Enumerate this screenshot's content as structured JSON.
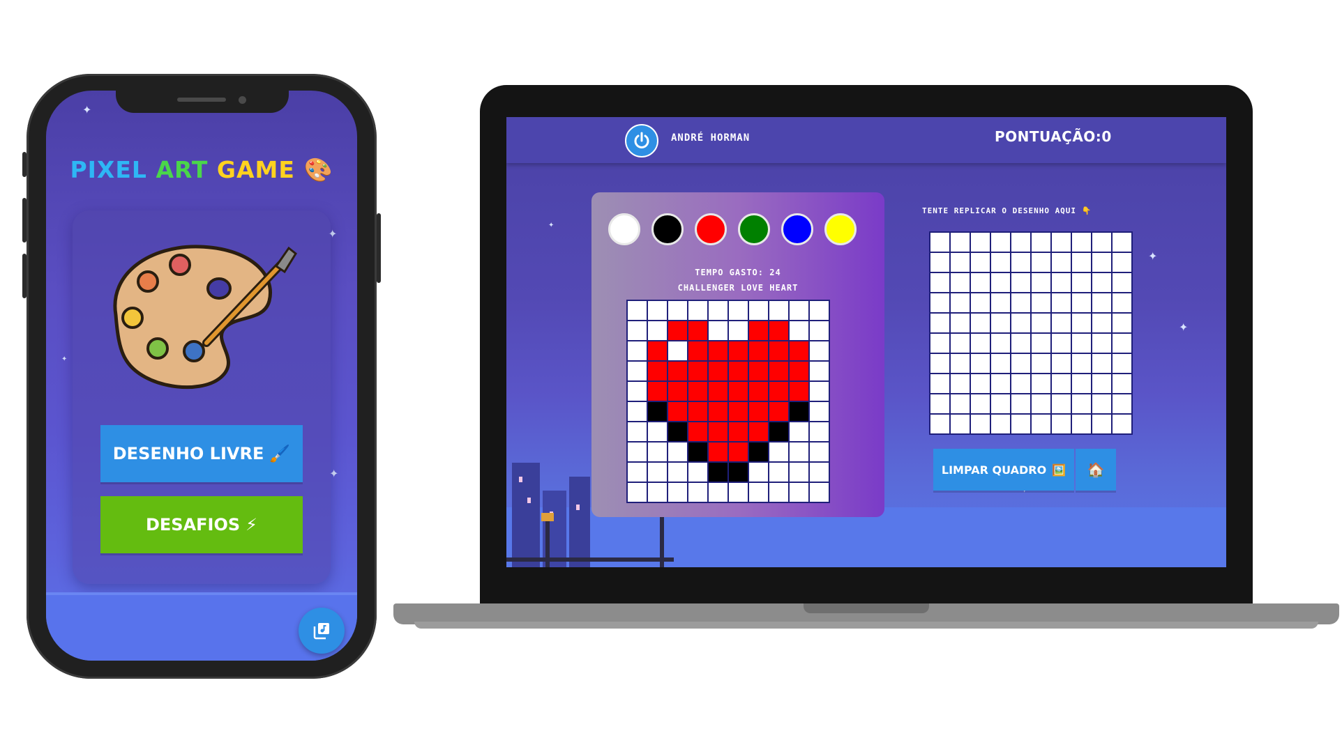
{
  "phone": {
    "title_words": [
      "PIXEL",
      "ART",
      "GAME"
    ],
    "title_emoji": "🎨",
    "buttons": {
      "free_draw": {
        "label": "DESENHO LIVRE",
        "emoji": "🖌️"
      },
      "challenges": {
        "label": "DESAFIOS",
        "emoji": "⚡"
      }
    },
    "fab_icon": "music-library-icon",
    "palette_icon": "paint-palette-icon"
  },
  "game": {
    "user": "ANDRÉ HORMAN",
    "score_label": "PONTUAÇÃO:",
    "score": "0",
    "power_icon": "power-icon",
    "swatches": [
      "#ffffff",
      "#000000",
      "#ff0000",
      "#008000",
      "#0000ff",
      "#ffff00"
    ],
    "time_label": "TEMPO GASTO:",
    "time_value": "24",
    "challenge_label": "CHALLENGER LOVE HEART",
    "pattern": [
      "..........",
      "..RR..RR..",
      ".R.RRRRRR.",
      ".RRRRRRRR.",
      ".RRRRRRRR.",
      ".KRRRRRRK.",
      "..KRRRRK..",
      "...KRRK...",
      "....KK....",
      ".........."
    ],
    "replicate_label": "TENTE REPLICAR O DESENHO AQUI",
    "replicate_emoji": "👇",
    "clear_button": {
      "label": "LIMPAR QUADRO",
      "emoji": "🖼️"
    },
    "home_button": {
      "emoji": "🏠"
    },
    "colors": {
      "primary_button": "#2e8fe4",
      "challenge_button": "#64bc10",
      "grid_border": "#1f1f7a"
    }
  }
}
